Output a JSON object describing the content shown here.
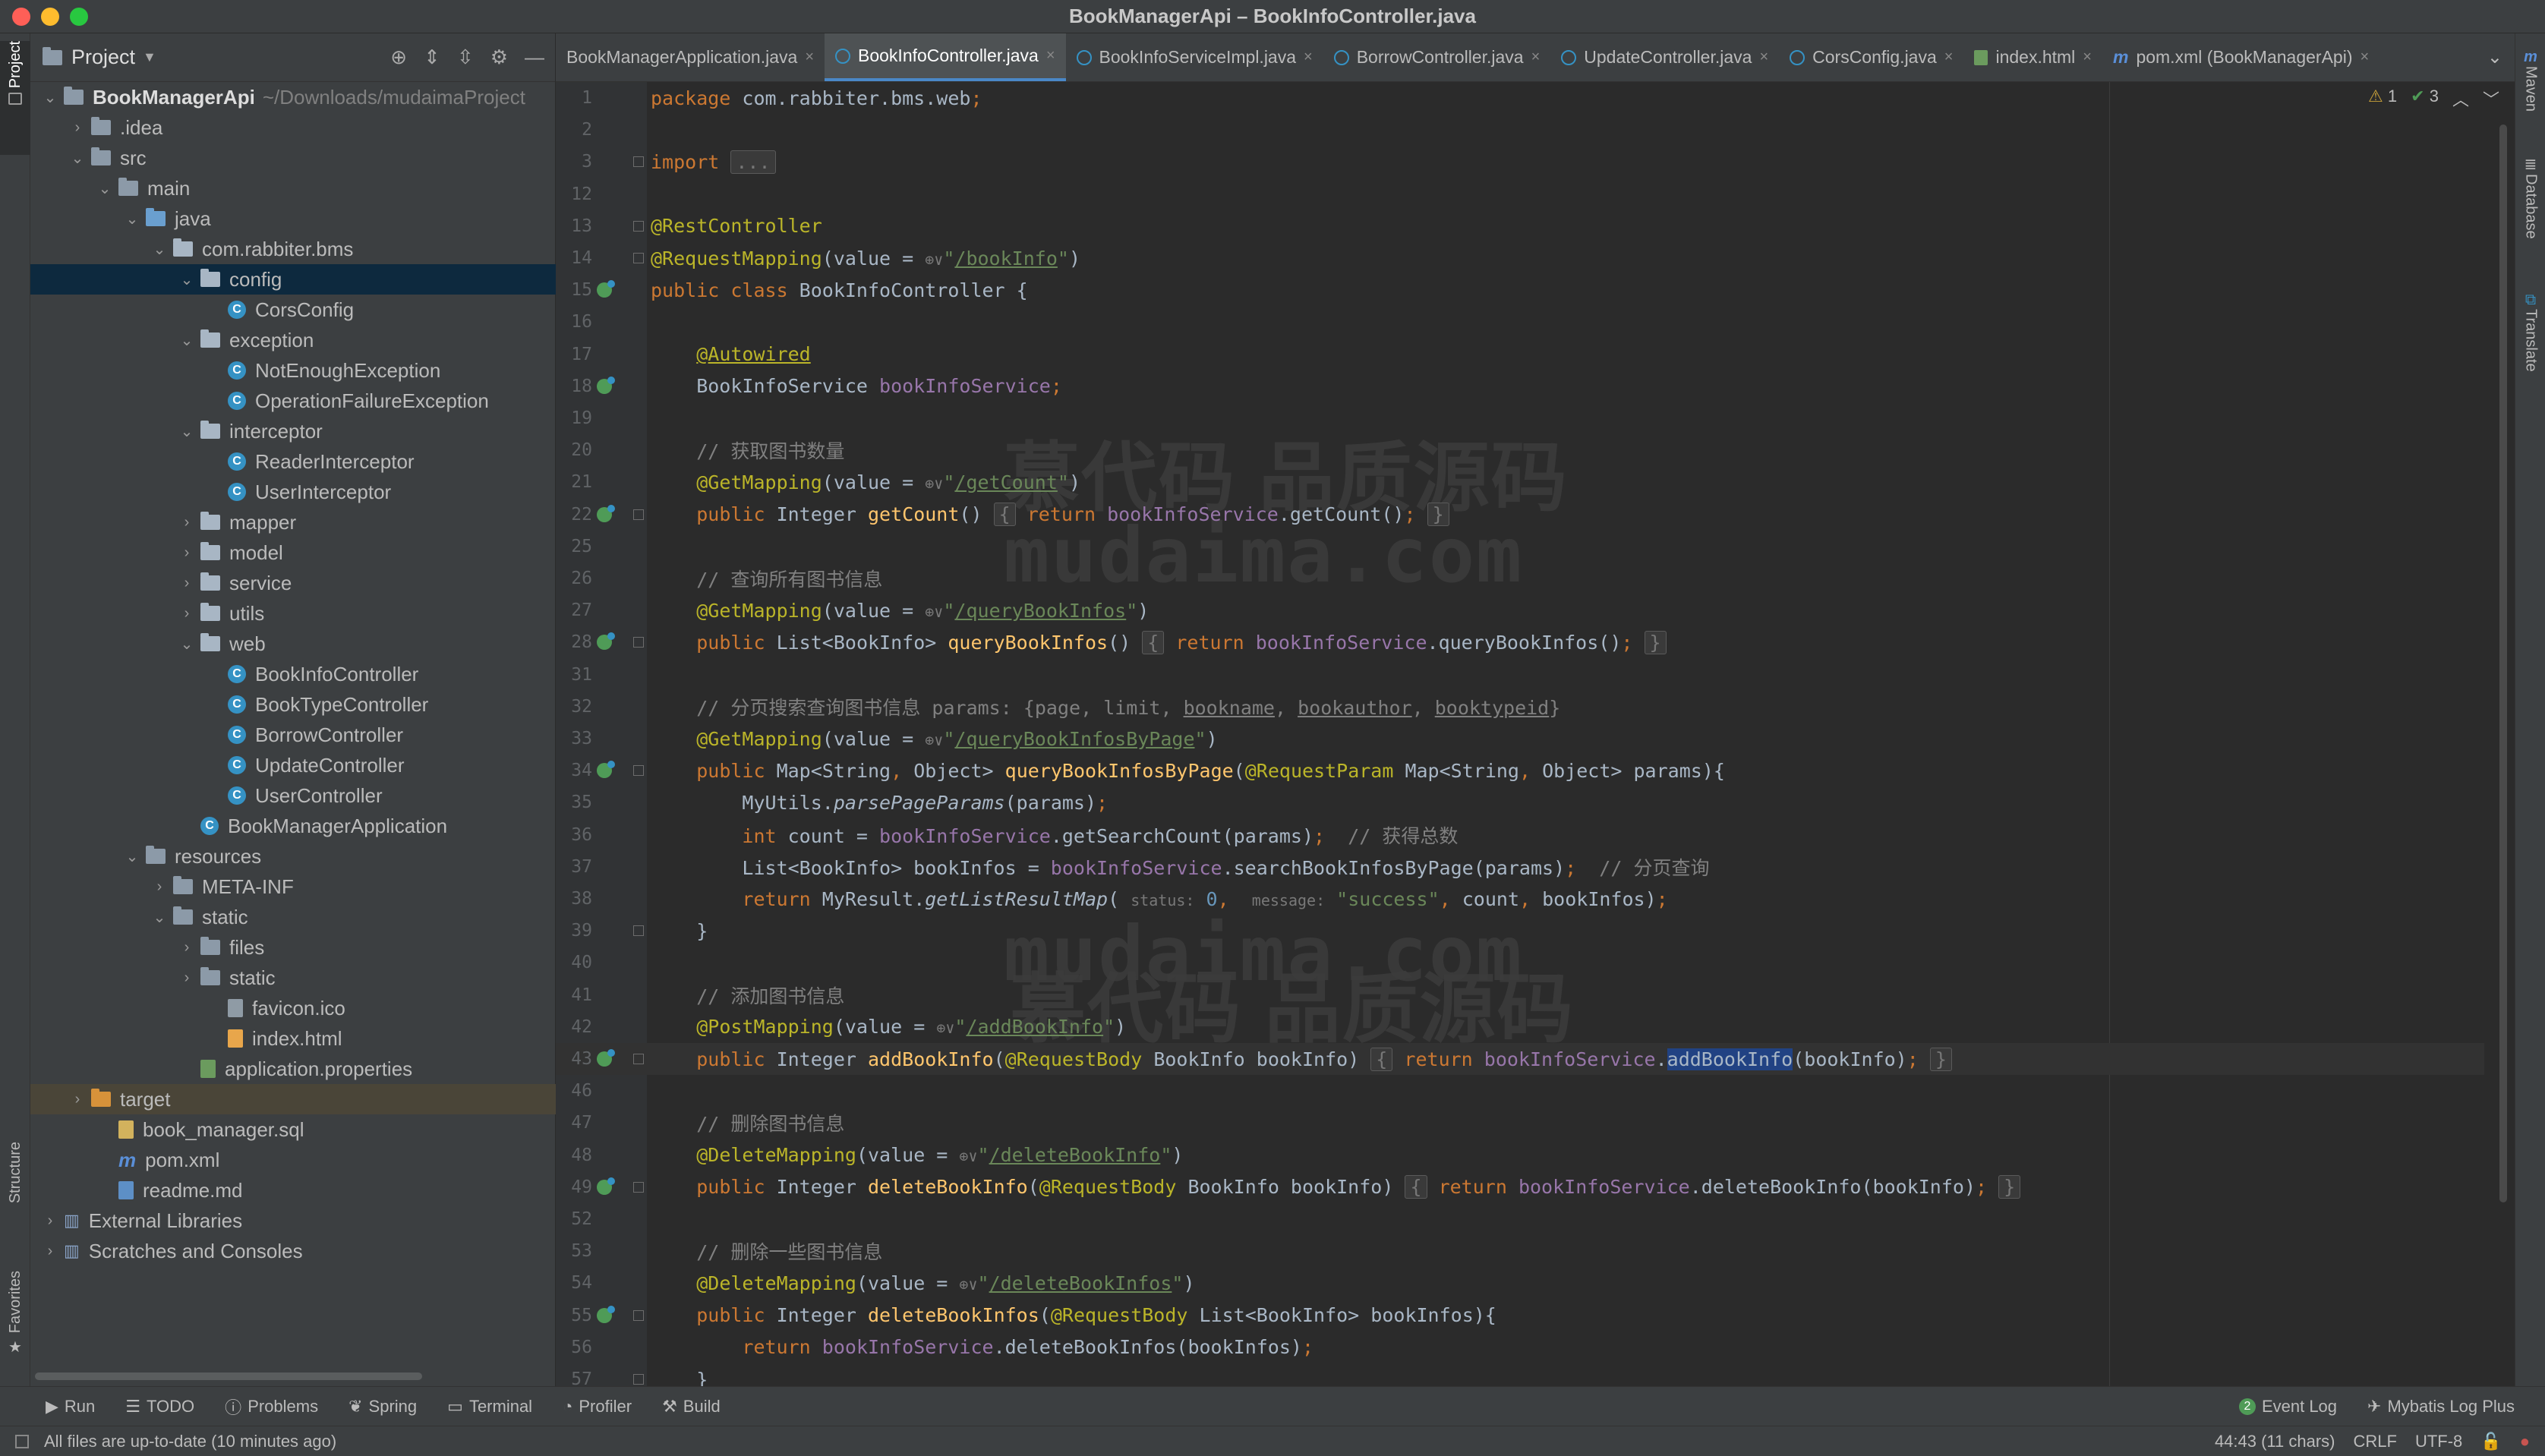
{
  "window": {
    "title": "BookManagerApi – BookInfoController.java"
  },
  "left_tools": {
    "project": "Project",
    "structure": "Structure",
    "favorites": "Favorites"
  },
  "right_tools": {
    "maven": "Maven",
    "database": "Database",
    "translate": "Translate"
  },
  "project_panel": {
    "title": "Project",
    "tree": [
      {
        "label": "BookManagerApi",
        "sub": "~/Downloads/mudaimaProject",
        "depth": 0,
        "arrow": "down",
        "icon": "folder",
        "bold": true
      },
      {
        "label": ".idea",
        "depth": 1,
        "arrow": "right",
        "icon": "folder"
      },
      {
        "label": "src",
        "depth": 1,
        "arrow": "down",
        "icon": "folder"
      },
      {
        "label": "main",
        "depth": 2,
        "arrow": "down",
        "icon": "folder"
      },
      {
        "label": "java",
        "depth": 3,
        "arrow": "down",
        "icon": "folder-blue"
      },
      {
        "label": "com.rabbiter.bms",
        "depth": 4,
        "arrow": "down",
        "icon": "pkg"
      },
      {
        "label": "config",
        "depth": 5,
        "arrow": "down",
        "icon": "pkg",
        "selected": true
      },
      {
        "label": "CorsConfig",
        "depth": 6,
        "arrow": "",
        "icon": "class"
      },
      {
        "label": "exception",
        "depth": 5,
        "arrow": "down",
        "icon": "pkg"
      },
      {
        "label": "NotEnoughException",
        "depth": 6,
        "arrow": "",
        "icon": "class"
      },
      {
        "label": "OperationFailureException",
        "depth": 6,
        "arrow": "",
        "icon": "class"
      },
      {
        "label": "interceptor",
        "depth": 5,
        "arrow": "down",
        "icon": "pkg"
      },
      {
        "label": "ReaderInterceptor",
        "depth": 6,
        "arrow": "",
        "icon": "class"
      },
      {
        "label": "UserInterceptor",
        "depth": 6,
        "arrow": "",
        "icon": "class"
      },
      {
        "label": "mapper",
        "depth": 5,
        "arrow": "right",
        "icon": "pkg"
      },
      {
        "label": "model",
        "depth": 5,
        "arrow": "right",
        "icon": "pkg"
      },
      {
        "label": "service",
        "depth": 5,
        "arrow": "right",
        "icon": "pkg"
      },
      {
        "label": "utils",
        "depth": 5,
        "arrow": "right",
        "icon": "pkg"
      },
      {
        "label": "web",
        "depth": 5,
        "arrow": "down",
        "icon": "pkg"
      },
      {
        "label": "BookInfoController",
        "depth": 6,
        "arrow": "",
        "icon": "class"
      },
      {
        "label": "BookTypeController",
        "depth": 6,
        "arrow": "",
        "icon": "class"
      },
      {
        "label": "BorrowController",
        "depth": 6,
        "arrow": "",
        "icon": "class"
      },
      {
        "label": "UpdateController",
        "depth": 6,
        "arrow": "",
        "icon": "class"
      },
      {
        "label": "UserController",
        "depth": 6,
        "arrow": "",
        "icon": "class"
      },
      {
        "label": "BookManagerApplication",
        "depth": 5,
        "arrow": "",
        "icon": "class"
      },
      {
        "label": "resources",
        "depth": 3,
        "arrow": "down",
        "icon": "folder"
      },
      {
        "label": "META-INF",
        "depth": 4,
        "arrow": "right",
        "icon": "folder"
      },
      {
        "label": "static",
        "depth": 4,
        "arrow": "down",
        "icon": "folder"
      },
      {
        "label": "files",
        "depth": 5,
        "arrow": "right",
        "icon": "folder"
      },
      {
        "label": "static",
        "depth": 5,
        "arrow": "right",
        "icon": "folder"
      },
      {
        "label": "favicon.ico",
        "depth": 6,
        "arrow": "",
        "icon": "file"
      },
      {
        "label": "index.html",
        "depth": 6,
        "arrow": "",
        "icon": "file-html"
      },
      {
        "label": "application.properties",
        "depth": 5,
        "arrow": "",
        "icon": "file-prop"
      },
      {
        "label": "target",
        "depth": 1,
        "arrow": "right",
        "icon": "folder-orange",
        "excluded": true
      },
      {
        "label": "book_manager.sql",
        "depth": 2,
        "arrow": "",
        "icon": "file-sql"
      },
      {
        "label": "pom.xml",
        "depth": 2,
        "arrow": "",
        "icon": "m"
      },
      {
        "label": "readme.md",
        "depth": 2,
        "arrow": "",
        "icon": "file-md"
      },
      {
        "label": "External Libraries",
        "depth": 0,
        "arrow": "right",
        "icon": "lib"
      },
      {
        "label": "Scratches and Consoles",
        "depth": 0,
        "arrow": "right",
        "icon": "lib"
      }
    ]
  },
  "tabs": [
    {
      "label": "BookManagerApplication.java",
      "icon": "none",
      "active": false
    },
    {
      "label": "BookInfoController.java",
      "icon": "class",
      "active": true
    },
    {
      "label": "BookInfoServiceImpl.java",
      "icon": "class",
      "active": false
    },
    {
      "label": "BorrowController.java",
      "icon": "class",
      "active": false
    },
    {
      "label": "UpdateController.java",
      "icon": "class",
      "active": false
    },
    {
      "label": "CorsConfig.java",
      "icon": "class",
      "active": false
    },
    {
      "label": "index.html",
      "icon": "html",
      "active": false
    },
    {
      "label": "pom.xml (BookManagerApi)",
      "icon": "m",
      "active": false
    }
  ],
  "inspections": {
    "warnings": "1",
    "ok": "3"
  },
  "code_lines": [
    {
      "n": "1",
      "html": "<span class=\"kw\">package</span> com.rabbiter.bms.web<span class=\"kw\">;</span>"
    },
    {
      "n": "2",
      "html": ""
    },
    {
      "n": "3",
      "html": "<span class=\"kw\">import</span> <span class=\"foldbox\">...</span>",
      "fold": true
    },
    {
      "n": "12",
      "html": ""
    },
    {
      "n": "13",
      "html": "<span class=\"an\">@RestController</span>",
      "fold": true
    },
    {
      "n": "14",
      "html": "<span class=\"an\">@RequestMapping</span>(value = <span class=\"hint\">⊕∨</span><span class=\"str\">\"</span><span class=\"url\">/bookInfo</span><span class=\"str\">\"</span>)",
      "fold": true
    },
    {
      "n": "15",
      "html": "<span class=\"kw\">public class</span> BookInfoController {",
      "bean": true
    },
    {
      "n": "16",
      "html": ""
    },
    {
      "n": "17",
      "html": "    <span class=\"an\" style=\"text-decoration:underline\">@Autowired</span>"
    },
    {
      "n": "18",
      "html": "    BookInfoService <span class=\"fld\">bookInfoService</span><span class=\"kw\">;</span>",
      "bean": true
    },
    {
      "n": "19",
      "html": ""
    },
    {
      "n": "20",
      "html": "    <span class=\"cm\">// 获取图书数量</span>"
    },
    {
      "n": "21",
      "html": "    <span class=\"an\">@GetMapping</span>(value = <span class=\"hint\">⊕∨</span><span class=\"str\">\"</span><span class=\"url\">/getCount</span><span class=\"str\">\"</span>)"
    },
    {
      "n": "22",
      "html": "    <span class=\"kw\">public</span> Integer <span class=\"fn\">getCount</span>() <span class=\"foldbox\">{</span> <span class=\"kw\">return</span> <span class=\"fld\">bookInfoService</span>.getCount()<span class=\"kw\">;</span> <span class=\"foldbox\">}</span>",
      "bean": true,
      "fold": true
    },
    {
      "n": "25",
      "html": ""
    },
    {
      "n": "26",
      "html": "    <span class=\"cm\">// 查询所有图书信息</span>"
    },
    {
      "n": "27",
      "html": "    <span class=\"an\">@GetMapping</span>(value = <span class=\"hint\">⊕∨</span><span class=\"str\">\"</span><span class=\"url\">/queryBookInfos</span><span class=\"str\">\"</span>)"
    },
    {
      "n": "28",
      "html": "    <span class=\"kw\">public</span> List&lt;BookInfo&gt; <span class=\"fn\">queryBookInfos</span>() <span class=\"foldbox\">{</span> <span class=\"kw\">return</span> <span class=\"fld\">bookInfoService</span>.queryBookInfos()<span class=\"kw\">;</span> <span class=\"foldbox\">}</span>",
      "bean": true,
      "fold": true
    },
    {
      "n": "31",
      "html": ""
    },
    {
      "n": "32",
      "html": "    <span class=\"cm\">// 分页搜索查询图书信息 params: {page, limit, <u>bookname</u>, <u>bookauthor</u>, <u>booktypeid</u>}</span>"
    },
    {
      "n": "33",
      "html": "    <span class=\"an\">@GetMapping</span>(value = <span class=\"hint\">⊕∨</span><span class=\"str\">\"</span><span class=\"url\">/queryBookInfosByPage</span><span class=\"str\">\"</span>)"
    },
    {
      "n": "34",
      "html": "    <span class=\"kw\">public</span> Map&lt;String<span class=\"kw\">,</span> Object&gt; <span class=\"fn\">queryBookInfosByPage</span>(<span class=\"an\">@RequestParam</span> Map&lt;String<span class=\"kw\">,</span> Object&gt; params){",
      "bean": true,
      "fold": true
    },
    {
      "n": "35",
      "html": "        MyUtils.<span class=\"it\">parsePageParams</span>(params)<span class=\"kw\">;</span>"
    },
    {
      "n": "36",
      "html": "        <span class=\"kw\">int</span> count = <span class=\"fld\">bookInfoService</span>.getSearchCount(params)<span class=\"kw\">;</span>  <span class=\"cm\">// 获得总数</span>"
    },
    {
      "n": "37",
      "html": "        List&lt;BookInfo&gt; bookInfos = <span class=\"fld\">bookInfoService</span>.searchBookInfosByPage(params)<span class=\"kw\">;</span>  <span class=\"cm\">// 分页查询</span>"
    },
    {
      "n": "38",
      "html": "        <span class=\"kw\">return</span> MyResult.<span class=\"it\">getListResultMap</span>( <span class=\"hint\">status:</span> <span class=\"num\">0</span><span class=\"kw\">,</span>  <span class=\"hint\">message:</span> <span class=\"str\">\"success\"</span><span class=\"kw\">,</span> count<span class=\"kw\">,</span> bookInfos)<span class=\"kw\">;</span>"
    },
    {
      "n": "39",
      "html": "    }",
      "fold": true
    },
    {
      "n": "40",
      "html": ""
    },
    {
      "n": "41",
      "html": "    <span class=\"cm\">// 添加图书信息</span>"
    },
    {
      "n": "42",
      "html": "    <span class=\"an\">@PostMapping</span>(value = <span class=\"hint\">⊕∨</span><span class=\"str\">\"</span><span class=\"url\">/addBookInfo</span><span class=\"str\">\"</span>)"
    },
    {
      "n": "43",
      "html": "    <span class=\"kw\">public</span> Integer <span class=\"fn\">addBookInfo</span>(<span class=\"an\">@RequestBody</span> BookInfo bookInfo) <span class=\"foldbox\">{</span> <span class=\"kw\">return</span> <span class=\"fld\">bookInfoService</span>.<span class=\"sel\">addBookInfo</span>(bookInfo)<span class=\"kw\">;</span> <span class=\"foldbox\">}</span>",
      "bean": true,
      "fold": true,
      "current": true
    },
    {
      "n": "46",
      "html": ""
    },
    {
      "n": "47",
      "html": "    <span class=\"cm\">// 删除图书信息</span>"
    },
    {
      "n": "48",
      "html": "    <span class=\"an\">@DeleteMapping</span>(value = <span class=\"hint\">⊕∨</span><span class=\"str\">\"</span><span class=\"url\">/deleteBookInfo</span><span class=\"str\">\"</span>)"
    },
    {
      "n": "49",
      "html": "    <span class=\"kw\">public</span> Integer <span class=\"fn\">deleteBookInfo</span>(<span class=\"an\">@RequestBody</span> BookInfo bookInfo) <span class=\"foldbox\">{</span> <span class=\"kw\">return</span> <span class=\"fld\">bookInfoService</span>.deleteBookInfo(bookInfo)<span class=\"kw\">;</span> <span class=\"foldbox\">}</span>",
      "bean": true,
      "fold": true
    },
    {
      "n": "52",
      "html": ""
    },
    {
      "n": "53",
      "html": "    <span class=\"cm\">// 删除一些图书信息</span>"
    },
    {
      "n": "54",
      "html": "    <span class=\"an\">@DeleteMapping</span>(value = <span class=\"hint\">⊕∨</span><span class=\"str\">\"</span><span class=\"url\">/deleteBookInfos</span><span class=\"str\">\"</span>)"
    },
    {
      "n": "55",
      "html": "    <span class=\"kw\">public</span> Integer <span class=\"fn\">deleteBookInfos</span>(<span class=\"an\">@RequestBody</span> List&lt;BookInfo&gt; bookInfos){",
      "bean": true,
      "fold": true
    },
    {
      "n": "56",
      "html": "        <span class=\"kw\">return</span> <span class=\"fld\">bookInfoService</span>.deleteBookInfos(bookInfos)<span class=\"kw\">;</span>"
    },
    {
      "n": "57",
      "html": "    }",
      "fold": true
    }
  ],
  "watermarks": [
    "慕代码 品质源码",
    "mudaima.com",
    "mudaima.com",
    "慕代码 品质源码"
  ],
  "bottom_tools": [
    "Run",
    "TODO",
    "Problems",
    "Spring",
    "Terminal",
    "Profiler",
    "Build"
  ],
  "bottom_right": {
    "event_log_count": "2",
    "event_log": "Event Log",
    "mybatis": "Mybatis Log Plus"
  },
  "status": {
    "message": "All files are up-to-date (10 minutes ago)",
    "position": "44:43 (11 chars)",
    "line_sep": "CRLF",
    "encoding": "UTF-8"
  }
}
